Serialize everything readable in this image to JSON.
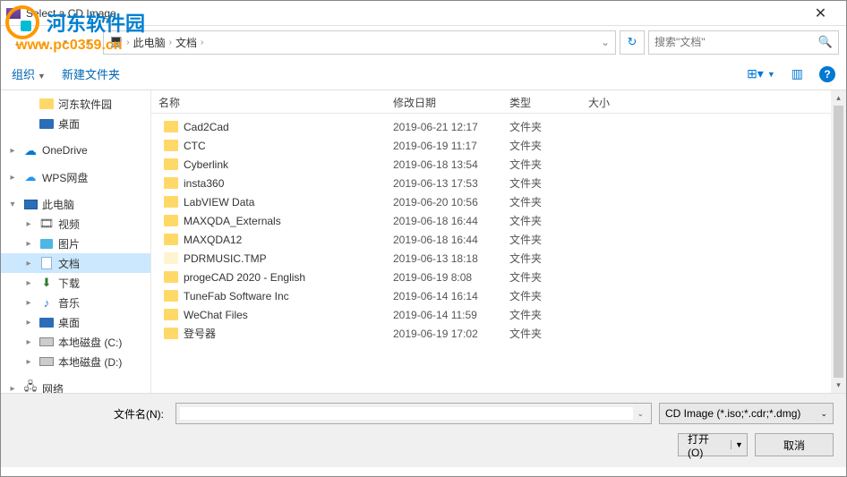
{
  "window": {
    "title": "Select a CD Image"
  },
  "watermark": {
    "text": "河东软件园",
    "url": "www.pc0359.cn"
  },
  "nav": {
    "breadcrumb": [
      "此电脑",
      "文档"
    ],
    "search_placeholder": "搜索\"文档\""
  },
  "toolbar": {
    "organize": "组织",
    "new_folder": "新建文件夹"
  },
  "headers": {
    "name": "名称",
    "date": "修改日期",
    "type": "类型",
    "size": "大小"
  },
  "sidebar": [
    {
      "indent": 1,
      "exp": "",
      "icon": "folder",
      "label": "河东软件园"
    },
    {
      "indent": 1,
      "exp": "",
      "icon": "desktop",
      "label": "桌面"
    },
    {
      "indent": 0,
      "exp": "",
      "icon": "",
      "label": ""
    },
    {
      "indent": 0,
      "exp": "▸",
      "icon": "cloud",
      "label": "OneDrive"
    },
    {
      "indent": 0,
      "exp": "",
      "icon": "",
      "label": ""
    },
    {
      "indent": 0,
      "exp": "▸",
      "icon": "wps",
      "label": "WPS网盘"
    },
    {
      "indent": 0,
      "exp": "",
      "icon": "",
      "label": ""
    },
    {
      "indent": 0,
      "exp": "▾",
      "icon": "pc",
      "label": "此电脑"
    },
    {
      "indent": 1,
      "exp": "▸",
      "icon": "video",
      "label": "视频"
    },
    {
      "indent": 1,
      "exp": "▸",
      "icon": "pic",
      "label": "图片"
    },
    {
      "indent": 1,
      "exp": "▸",
      "icon": "doc",
      "label": "文档",
      "selected": true
    },
    {
      "indent": 1,
      "exp": "▸",
      "icon": "dl",
      "label": "下载"
    },
    {
      "indent": 1,
      "exp": "▸",
      "icon": "music",
      "label": "音乐"
    },
    {
      "indent": 1,
      "exp": "▸",
      "icon": "desktop",
      "label": "桌面"
    },
    {
      "indent": 1,
      "exp": "▸",
      "icon": "drive",
      "label": "本地磁盘 (C:)"
    },
    {
      "indent": 1,
      "exp": "▸",
      "icon": "drive",
      "label": "本地磁盘 (D:)"
    },
    {
      "indent": 0,
      "exp": "",
      "icon": "",
      "label": ""
    },
    {
      "indent": 0,
      "exp": "▸",
      "icon": "net",
      "label": "网络"
    }
  ],
  "files": [
    {
      "name": "Cad2Cad",
      "date": "2019-06-21 12:17",
      "type": "文件夹"
    },
    {
      "name": "CTC",
      "date": "2019-06-19 11:17",
      "type": "文件夹"
    },
    {
      "name": "Cyberlink",
      "date": "2019-06-18 13:54",
      "type": "文件夹"
    },
    {
      "name": "insta360",
      "date": "2019-06-13 17:53",
      "type": "文件夹"
    },
    {
      "name": "LabVIEW Data",
      "date": "2019-06-20 10:56",
      "type": "文件夹"
    },
    {
      "name": "MAXQDA_Externals",
      "date": "2019-06-18 16:44",
      "type": "文件夹"
    },
    {
      "name": "MAXQDA12",
      "date": "2019-06-18 16:44",
      "type": "文件夹"
    },
    {
      "name": "PDRMUSIC.TMP",
      "date": "2019-06-13 18:18",
      "type": "文件夹",
      "tmp": true
    },
    {
      "name": "progeCAD 2020 - English",
      "date": "2019-06-19 8:08",
      "type": "文件夹"
    },
    {
      "name": "TuneFab Software Inc",
      "date": "2019-06-14 16:14",
      "type": "文件夹"
    },
    {
      "name": "WeChat Files",
      "date": "2019-06-14 11:59",
      "type": "文件夹"
    },
    {
      "name": "登号器",
      "date": "2019-06-19 17:02",
      "type": "文件夹"
    }
  ],
  "bottom": {
    "filename_label": "文件名(N):",
    "filter_text": "CD Image (*.iso;*.cdr;*.dmg)",
    "open_btn": "打开(O)",
    "cancel_btn": "取消"
  }
}
